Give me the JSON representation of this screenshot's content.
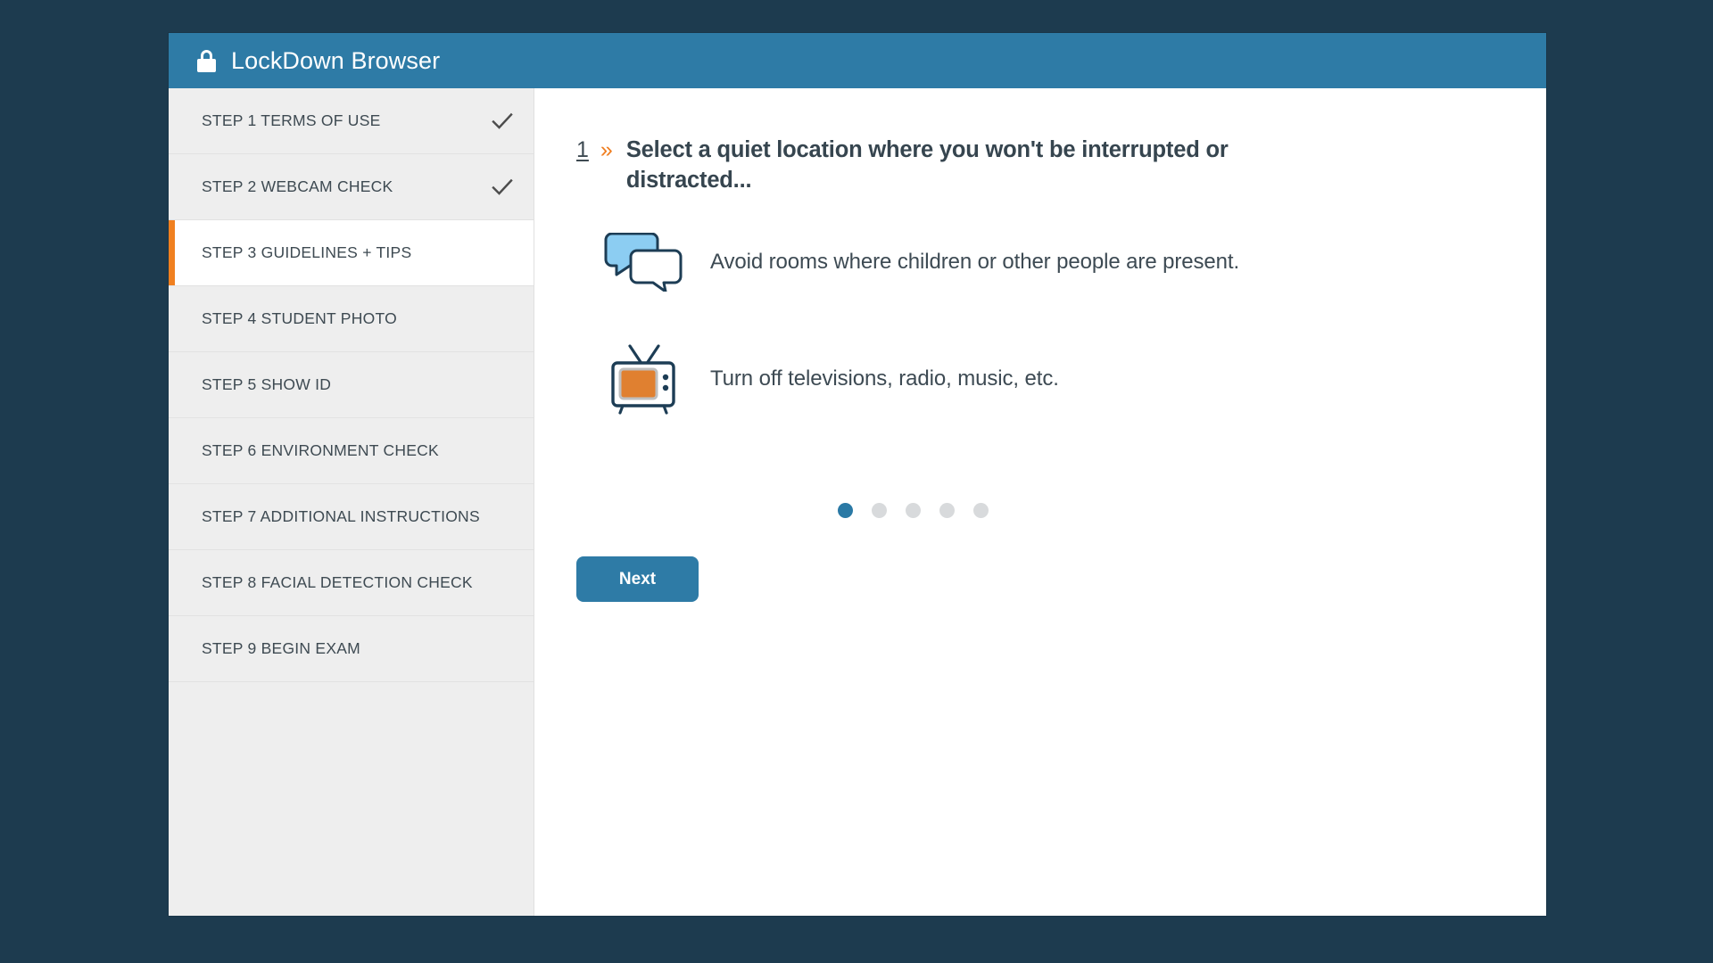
{
  "window": {
    "titlebar": {
      "lock_icon": "lock-icon",
      "title": "LockDown Browser",
      "background_color": "#2e7ba6"
    }
  },
  "sidebar": {
    "items": [
      {
        "label": "STEP 1 TERMS OF USE",
        "completed": true,
        "active": false
      },
      {
        "label": "STEP 2 WEBCAM CHECK",
        "completed": true,
        "active": false
      },
      {
        "label": "STEP 3 GUIDELINES + TIPS",
        "completed": false,
        "active": true
      },
      {
        "label": "STEP 4 STUDENT PHOTO",
        "completed": false,
        "active": false
      },
      {
        "label": "STEP 5 SHOW ID",
        "completed": false,
        "active": false
      },
      {
        "label": "STEP 6 ENVIRONMENT CHECK",
        "completed": false,
        "active": false
      },
      {
        "label": "STEP 7 ADDITIONAL INSTRUCTIONS",
        "completed": false,
        "active": false
      },
      {
        "label": "STEP 8 FACIAL DETECTION CHECK",
        "completed": false,
        "active": false
      },
      {
        "label": "STEP 9 BEGIN EXAM",
        "completed": false,
        "active": false
      }
    ],
    "active_accent_color": "#f08020",
    "check_icon": "check-icon"
  },
  "main": {
    "heading": {
      "number": "1",
      "separator": "»",
      "text": "Select a quiet location where you won't be interrupted or distracted..."
    },
    "tips": [
      {
        "icon": "speech-bubbles-icon",
        "text": "Avoid rooms where children or other people are present."
      },
      {
        "icon": "television-icon",
        "text": "Turn off televisions, radio, music, etc."
      }
    ],
    "pager": {
      "total": 5,
      "current": 1
    },
    "next_button": {
      "label": "Next",
      "color": "#2e7ba6"
    }
  }
}
